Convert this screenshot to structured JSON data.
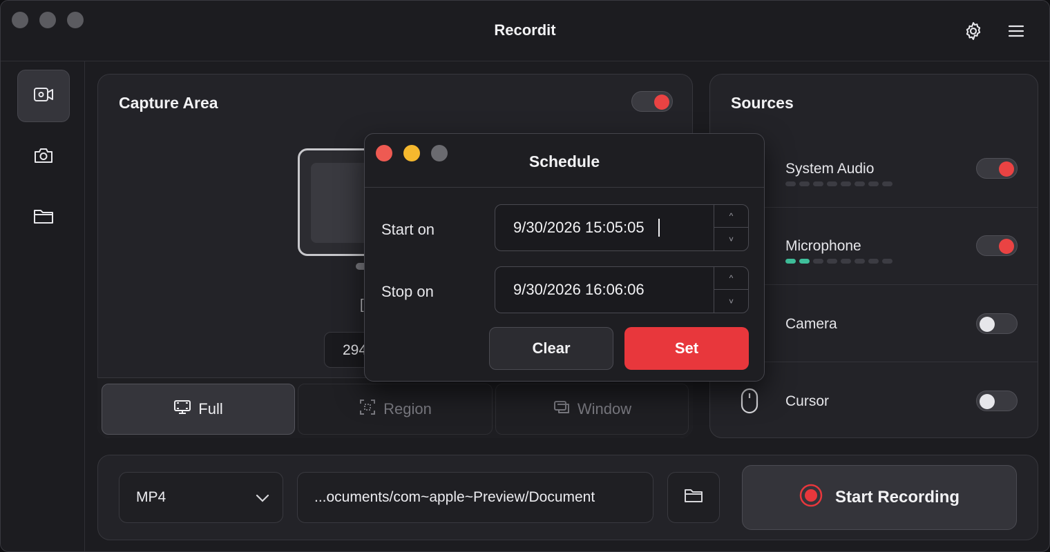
{
  "app": {
    "title": "Recordit"
  },
  "capture": {
    "title": "Capture Area",
    "partial_bracket": "[",
    "partial_number": "294",
    "modes": [
      {
        "label": "Full",
        "icon": "monitor-icon"
      },
      {
        "label": "Region",
        "icon": "region-select-icon"
      },
      {
        "label": "Window",
        "icon": "window-icon"
      }
    ]
  },
  "sources": {
    "title": "Sources",
    "items": [
      {
        "label": "System Audio",
        "enabled": true,
        "meter_lit": 0
      },
      {
        "label": "Microphone",
        "enabled": true,
        "meter_lit": 2
      },
      {
        "label": "Camera",
        "enabled": false
      },
      {
        "label": "Cursor",
        "enabled": false,
        "icon": "mouse-icon"
      }
    ]
  },
  "bottom": {
    "format": "MP4",
    "path": "...ocuments/com~apple~Preview/Document",
    "record_label": "Start Recording"
  },
  "schedule": {
    "title": "Schedule",
    "start_label": "Start on",
    "start_value": "9/30/2026 15:05:05",
    "stop_label": "Stop on",
    "stop_value": "9/30/2026 16:06:06",
    "clear_label": "Clear",
    "set_label": "Set"
  },
  "colors": {
    "accent": "#e8373c",
    "meter": "#3fbf9b",
    "close": "#ee5a52",
    "minimize": "#f5b82e"
  }
}
